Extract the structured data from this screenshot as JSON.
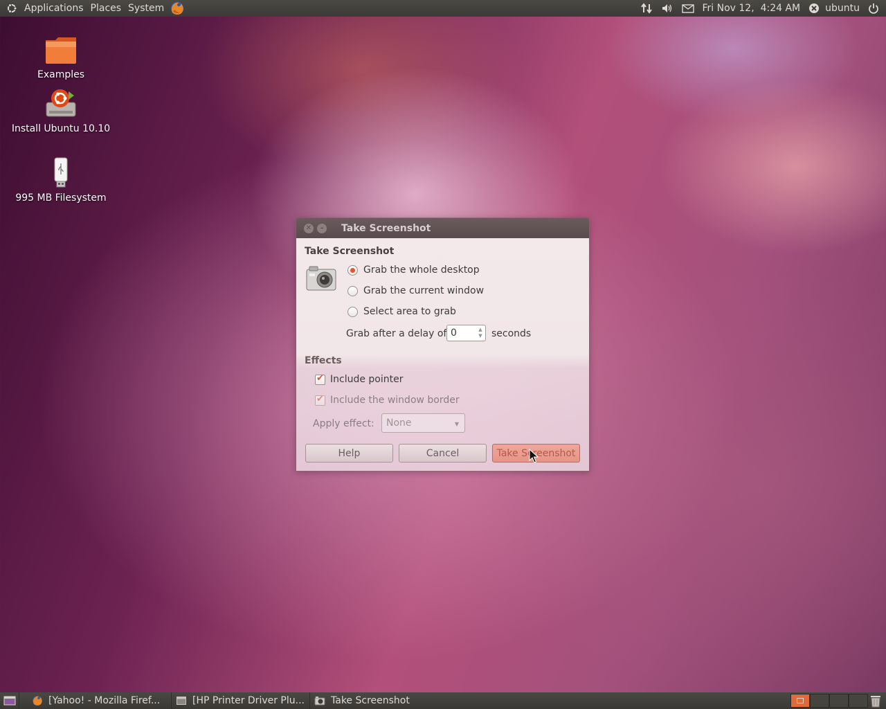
{
  "top_panel": {
    "menus": [
      "Applications",
      "Places",
      "System"
    ],
    "clock": "Fri Nov 12,  4:24 AM",
    "user": "ubuntu",
    "icons": [
      "ubuntu-logo-icon",
      "firefox-icon",
      "network-icon",
      "volume-icon",
      "mail-icon",
      "user-status-icon",
      "power-icon"
    ]
  },
  "desktop": {
    "icons": [
      {
        "label": "Examples",
        "icon": "folder-icon"
      },
      {
        "label": "Install Ubuntu 10.10",
        "icon": "installer-icon"
      },
      {
        "label": "995 MB Filesystem",
        "icon": "usb-drive-icon"
      }
    ]
  },
  "dialog": {
    "window_title": "Take Screenshot",
    "section_title": "Take Screenshot",
    "options": [
      {
        "label": "Grab the whole desktop",
        "checked": true
      },
      {
        "label": "Grab the current window",
        "checked": false
      },
      {
        "label": "Select area to grab",
        "checked": false
      }
    ],
    "delay_label": "Grab after a delay of",
    "delay_value": "0",
    "delay_unit": "seconds",
    "effects_title": "Effects",
    "include_pointer": {
      "label": "Include pointer",
      "checked": true
    },
    "include_border": {
      "label": "Include the window border",
      "checked": true
    },
    "apply_effect_label": "Apply effect:",
    "apply_effect_value": "None",
    "buttons": {
      "help": "Help",
      "cancel": "Cancel",
      "take": "Take Screenshot"
    }
  },
  "taskbar": {
    "tasks": [
      {
        "label": "[Yahoo! - Mozilla Firef...",
        "icon": "firefox-icon"
      },
      {
        "label": "[HP Printer Driver Plu...",
        "icon": "window-icon"
      },
      {
        "label": "Take Screenshot",
        "icon": "camera-icon"
      }
    ],
    "workspaces": 4,
    "active_workspace": 1
  },
  "colors": {
    "accent": "#e1572b",
    "panel": "#3c3b37",
    "dialog_title": "#5e5052"
  }
}
